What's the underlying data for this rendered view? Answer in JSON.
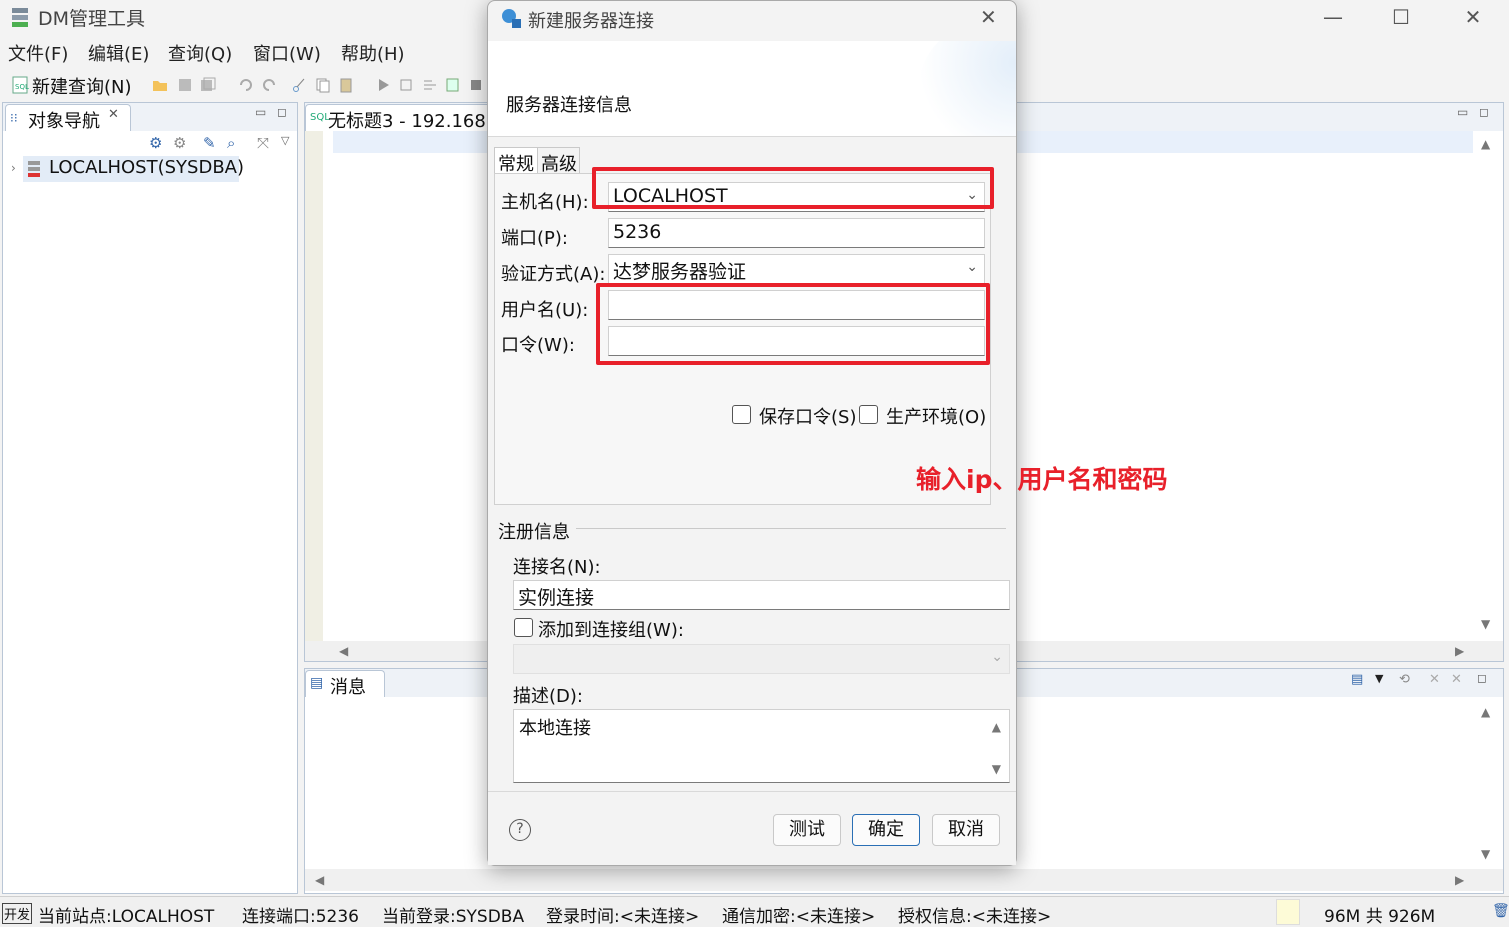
{
  "window": {
    "title": "DM管理工具"
  },
  "menu": [
    "文件(F)",
    "编辑(E)",
    "查询(Q)",
    "窗口(W)",
    "帮助(H)"
  ],
  "toolbar": {
    "new_query": "新建查询(N)"
  },
  "navigator": {
    "tab": "对象导航",
    "tree_item": "LOCALHOST(SYSDBA)"
  },
  "editor": {
    "tab": "无标题3 - 192.168.2"
  },
  "messages": {
    "tab": "消息"
  },
  "status": {
    "badge": "开发",
    "site": "当前站点:LOCALHOST",
    "port": "连接端口:5236",
    "login": "当前登录:SYSDBA",
    "login_time": "登录时间:<未连接>",
    "encryption": "通信加密:<未连接>",
    "license": "授权信息:<未连接>",
    "memory": "96M 共 926M"
  },
  "dialog": {
    "title": "新建服务器连接",
    "header": "服务器连接信息",
    "tabs": [
      "常规",
      "高级"
    ],
    "host": {
      "label": "主机名(H):",
      "value": "LOCALHOST"
    },
    "port": {
      "label": "端口(P):",
      "value": "5236"
    },
    "auth": {
      "label": "验证方式(A):",
      "value": "达梦服务器验证"
    },
    "user": {
      "label": "用户名(U):",
      "value": ""
    },
    "password": {
      "label": "口令(W):",
      "value": ""
    },
    "save_password": "保存口令(S)",
    "production": "生产环境(O)",
    "annotation": "输入ip、用户名和密码",
    "register_section": "注册信息",
    "conn_name": {
      "label": "连接名(N):",
      "value": "实例连接"
    },
    "add_group": "添加到连接组(W):",
    "desc": {
      "label": "描述(D):",
      "value": "本地连接"
    },
    "buttons": {
      "test": "测试",
      "ok": "确定",
      "cancel": "取消"
    },
    "help": "?"
  },
  "colors": {
    "accent_red": "#e8202a",
    "selection": "#e3ecf7"
  }
}
